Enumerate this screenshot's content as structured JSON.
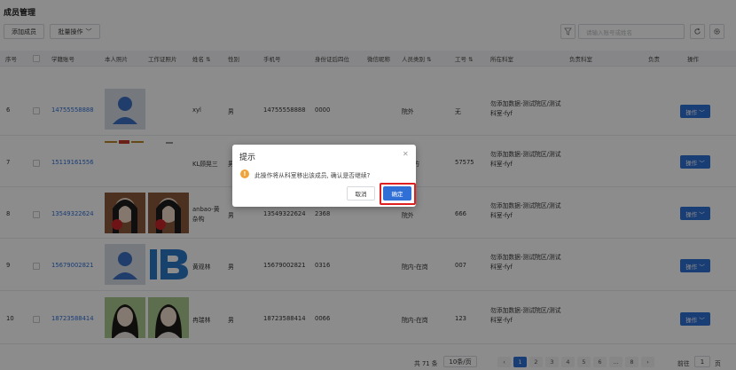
{
  "page": {
    "title": "成员管理",
    "add_member_label": "添加成员",
    "batch_ops_label": "批量操作",
    "search_placeholder": "请输入账号或姓名"
  },
  "table": {
    "headers": {
      "seq": "序号",
      "student_id": "学籍账号",
      "personal_photo": "本人照片",
      "work_photo": "工作证照片",
      "name": "姓名",
      "gender": "性别",
      "phone": "手机号",
      "id_last4": "身份证后四位",
      "wechat": "微信昵称",
      "personnel_type": "人员类别",
      "job_no": "工号",
      "department": "所在科室",
      "responsible_dept": "负责科室",
      "responsible_short": "负责",
      "operation": "操作"
    },
    "rows": [
      {
        "seq": "6",
        "account": "14755558888",
        "name": "xyl",
        "gender": "男",
        "phone": "14755558888",
        "id4": "0000",
        "type": "院外",
        "job": "无",
        "dept": "勿添加数据-测试院区/测试科室-fyf",
        "op": "操作"
      },
      {
        "seq": "7",
        "account": "15119161556",
        "name": "KL顾晃三",
        "gender": "男",
        "phone": "",
        "id4": "",
        "type": "第三方",
        "job": "57575",
        "dept": "勿添加数据-测试院区/测试科室-fyf",
        "op": "操作"
      },
      {
        "seq": "8",
        "account": "13549322624",
        "name": "anbao-黄杂构",
        "gender": "男",
        "phone": "13549322624",
        "id4": "2368",
        "type": "院外",
        "job": "666",
        "dept": "勿添加数据-测试院区/测试科室-fyf",
        "op": "操作"
      },
      {
        "seq": "9",
        "account": "15679002821",
        "name": "黄观林",
        "gender": "男",
        "phone": "15679002821",
        "id4": "0316",
        "type": "院内-在岗",
        "job": "007",
        "dept": "勿添加数据-测试院区/测试科室-fyf",
        "op": "操作"
      },
      {
        "seq": "10",
        "account": "18723588414",
        "name": "冉瑞林",
        "gender": "男",
        "phone": "18723588414",
        "id4": "0066",
        "type": "院内-在岗",
        "job": "123",
        "dept": "勿添加数据-测试院区/测试科室-fyf",
        "op": "操作"
      }
    ]
  },
  "pagination": {
    "total": "共 71 条",
    "page_size": "10条/页",
    "pages": [
      "1",
      "2",
      "3",
      "4",
      "5",
      "6",
      "...",
      "8"
    ],
    "goto_label": "前往",
    "goto_value": "1",
    "page_suffix": "页"
  },
  "dialog": {
    "title": "提示",
    "message": "此操作将从科室移出该成员, 确认是否继续?",
    "cancel_label": "取消",
    "confirm_label": "确定",
    "warning_icon": "!"
  },
  "colors": {
    "accent": "#2f6fd6",
    "warning": "#f1a33b",
    "highlight": "#e02020"
  }
}
